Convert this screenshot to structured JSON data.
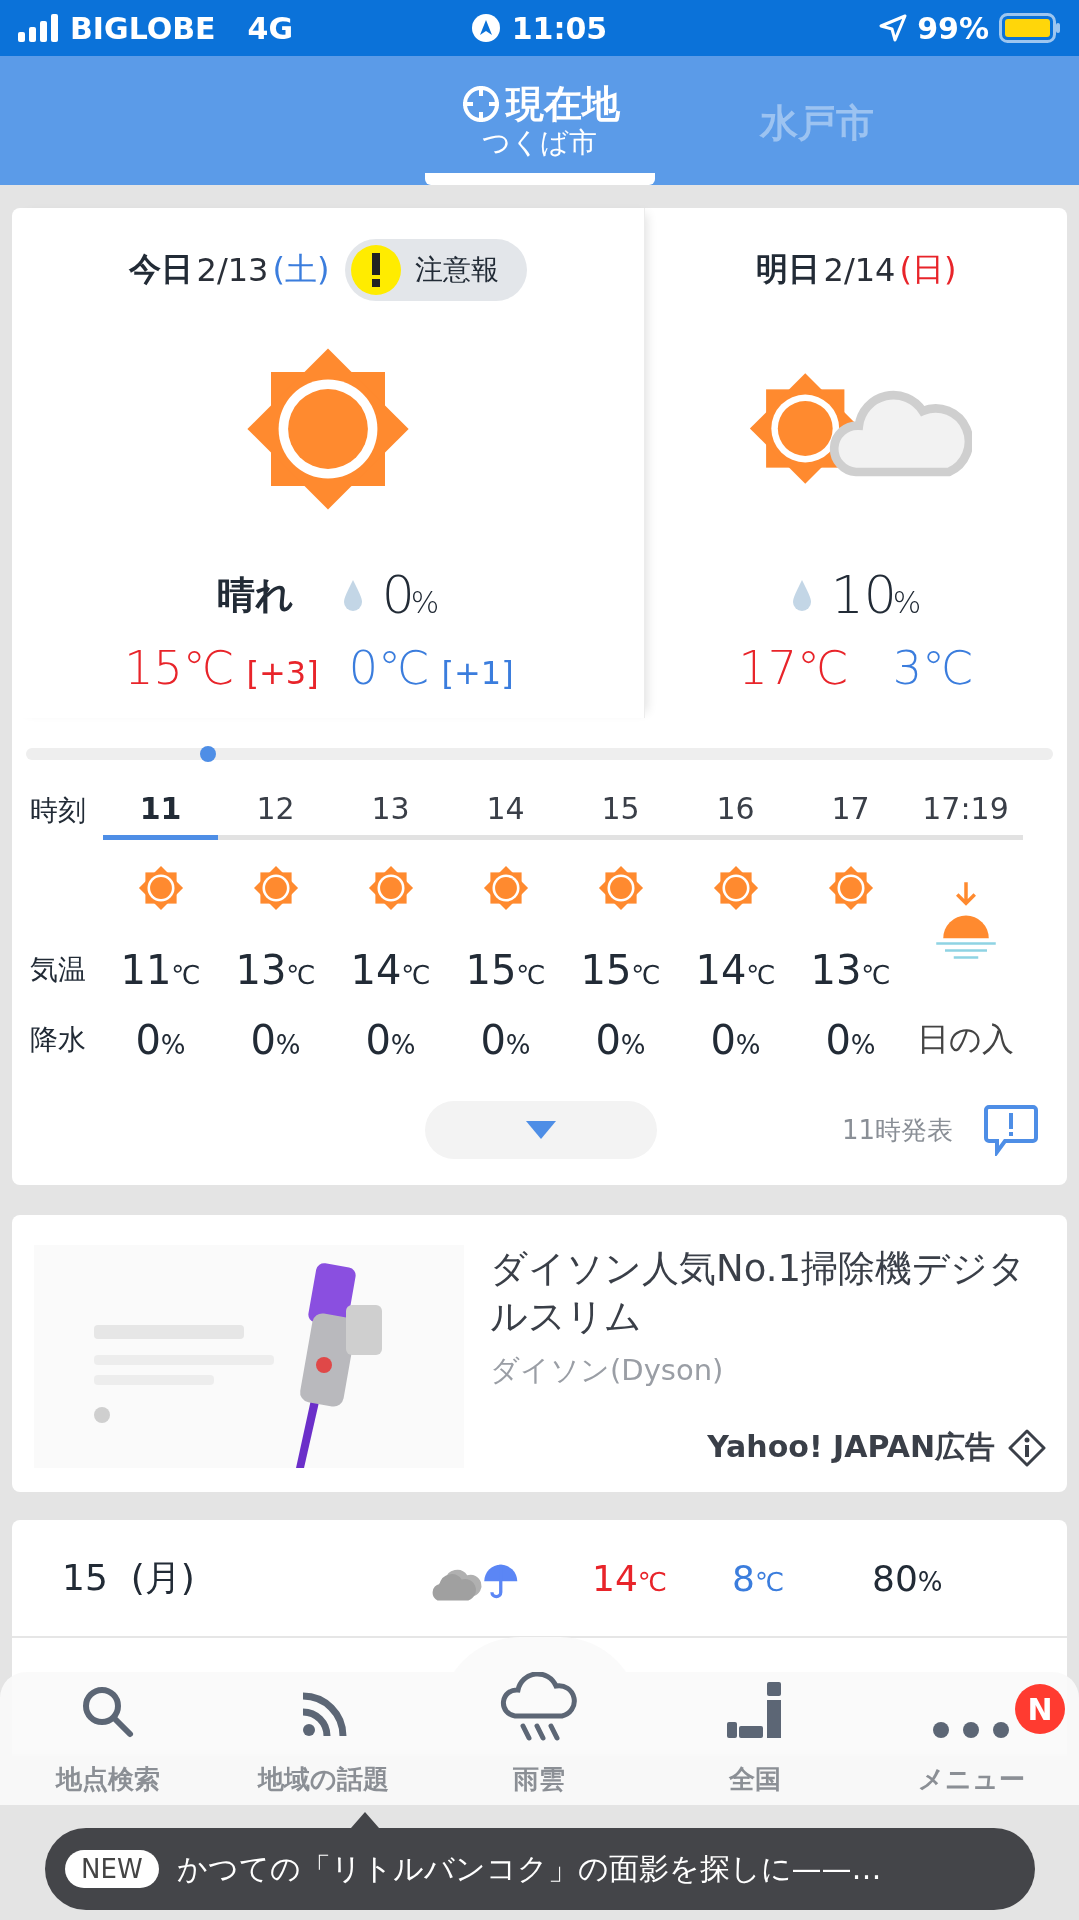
{
  "status_bar": {
    "carrier": "BIGLOBE",
    "network": "4G",
    "time": "11:05",
    "battery": "99%"
  },
  "location_tabs": [
    {
      "label": "現在地",
      "sublabel": "つくば市",
      "kind": "current",
      "selected": true
    },
    {
      "label": "水戸市",
      "kind": "city",
      "selected": false
    }
  ],
  "days": [
    {
      "label": "今日",
      "date": "2/13",
      "weekday": "(土)",
      "color": "#3b7ddd",
      "alert": "注意報",
      "kind": "sunny",
      "condition": "晴れ",
      "precip": "0%",
      "high": "15℃",
      "high_diff": "[+3]",
      "low": "0℃",
      "low_diff": "[+1]"
    },
    {
      "label": "明日",
      "date": "2/14",
      "weekday": "(日)",
      "color": "#e8242a",
      "kind": "sunny-cloudy",
      "precip": "10%",
      "high": "17℃",
      "low": "3℃"
    }
  ],
  "hourly": {
    "row_labels": [
      "時刻",
      "気温",
      "降水"
    ],
    "hours": [
      {
        "time": "11",
        "kind": "sunny",
        "selected": true,
        "temp": "11℃",
        "precip": "0%"
      },
      {
        "time": "12",
        "kind": "sunny",
        "selected": false,
        "temp": "13℃",
        "precip": "0%"
      },
      {
        "time": "13",
        "kind": "sunny",
        "selected": false,
        "temp": "14℃",
        "precip": "0%"
      },
      {
        "time": "14",
        "kind": "sunny",
        "selected": false,
        "temp": "15℃",
        "precip": "0%"
      },
      {
        "time": "15",
        "kind": "sunny",
        "selected": false,
        "temp": "15℃",
        "precip": "0%"
      },
      {
        "time": "16",
        "kind": "sunny",
        "selected": false,
        "temp": "14℃",
        "precip": "0%"
      },
      {
        "time": "17",
        "kind": "sunny",
        "selected": false,
        "temp": "13℃",
        "precip": "0%"
      },
      {
        "time": "17:19",
        "kind": "sunset",
        "selected": false,
        "label": "日の入"
      }
    ],
    "issued": "11時発表"
  },
  "ad": {
    "title": "ダイソン人気No.1掃除機デジタルスリム",
    "advertiser": "ダイソン(Dyson)",
    "sponsor": "Yahoo! JAPAN広告"
  },
  "daily": [
    {
      "day": "15",
      "weekday": "(月)",
      "kind": "cloudy-rain",
      "high": "14℃",
      "low": "8℃",
      "precip": "80%"
    }
  ],
  "nav": [
    {
      "label": "地点検索",
      "kind": "search"
    },
    {
      "label": "地域の話題",
      "kind": "feed"
    },
    {
      "label": "雨雲",
      "kind": "rain"
    },
    {
      "label": "全国",
      "kind": "map"
    },
    {
      "label": "メニュー",
      "kind": "more",
      "badge": "N"
    }
  ],
  "toast": {
    "tag": "NEW",
    "text": "かつての「リトルバンコク」の面影を探しに——…"
  }
}
